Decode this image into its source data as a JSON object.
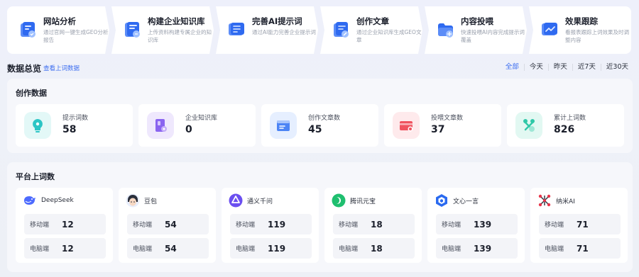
{
  "steps": [
    {
      "title": "网站分析",
      "desc": "通过官网一键生成GEO分析报告",
      "icon": "website-analysis-icon"
    },
    {
      "title": "构建企业知识库",
      "desc": "上传资料构建专属企业的知识库",
      "icon": "knowledge-base-icon"
    },
    {
      "title": "完善AI提示词",
      "desc": "通过AI能力完善企业提示词",
      "icon": "prompt-icon"
    },
    {
      "title": "创作文章",
      "desc": "通过企业知识库生成GEO文章",
      "icon": "article-icon"
    },
    {
      "title": "内容投喂",
      "desc": "快速投喂AI内容完成提示词覆盖",
      "icon": "content-feed-icon"
    },
    {
      "title": "效果跟踪",
      "desc": "看报表跟踪上词效果及时调整内容",
      "icon": "tracking-icon"
    }
  ],
  "overview": {
    "title": "数据总览",
    "link": "查看上词数据",
    "filters": [
      "全部",
      "今天",
      "昨天",
      "近7天",
      "近30天"
    ],
    "active_filter": "全部"
  },
  "creation": {
    "title": "创作数据",
    "stats": [
      {
        "label": "提示词数",
        "value": "58",
        "icon": "prompt-count-icon",
        "color": "#2bc5c5"
      },
      {
        "label": "企业知识库",
        "value": "0",
        "icon": "knowledge-base-count-icon",
        "color": "#8a64f0"
      },
      {
        "label": "创作文章数",
        "value": "45",
        "icon": "article-count-icon",
        "color": "#4c84f5"
      },
      {
        "label": "投喂文章数",
        "value": "37",
        "icon": "fed-article-icon",
        "color": "#f0525f"
      },
      {
        "label": "累计上词数",
        "value": "826",
        "icon": "keyword-total-icon",
        "color": "#2fc8a8"
      }
    ]
  },
  "platforms": {
    "title": "平台上词数",
    "metric_labels": {
      "mobile": "移动端",
      "pc": "电脑端"
    },
    "items": [
      {
        "name": "DeepSeek",
        "mobile": "12",
        "pc": "12",
        "icon": "deepseek-logo-icon"
      },
      {
        "name": "豆包",
        "mobile": "54",
        "pc": "54",
        "icon": "doubao-logo-icon"
      },
      {
        "name": "通义千问",
        "mobile": "119",
        "pc": "119",
        "icon": "tongyi-logo-icon"
      },
      {
        "name": "腾讯元宝",
        "mobile": "18",
        "pc": "18",
        "icon": "yuanbao-logo-icon"
      },
      {
        "name": "文心一言",
        "mobile": "139",
        "pc": "139",
        "icon": "wenxin-logo-icon"
      },
      {
        "name": "纳米AI",
        "mobile": "71",
        "pc": "71",
        "icon": "nami-logo-icon"
      }
    ]
  }
}
